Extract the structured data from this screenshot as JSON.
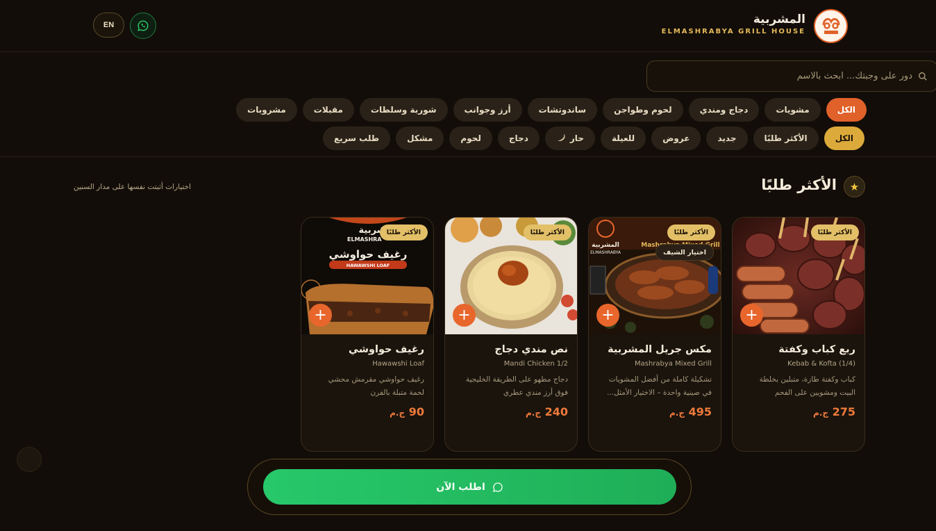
{
  "header": {
    "brand_ar": "المشربية",
    "brand_en": "ELMASHRABYA GRILL HOUSE",
    "lang": "EN",
    "logo_text": "المشربية"
  },
  "search": {
    "placeholder": "دور على وجبتك... ابحث بالاسم"
  },
  "categories": [
    "الكل",
    "مشويات",
    "دجاج ومندي",
    "لحوم وطواجن",
    "ساندوتشات",
    "أرز وجوانب",
    "شوربة وسلطات",
    "مقبلات",
    "مشروبات"
  ],
  "filters": [
    "الكل",
    "الأكثر طلبًا",
    "جديد",
    "عروض",
    "للعيلة",
    "حار",
    "دجاج",
    "لحوم",
    "مشكل",
    "طلب سريع"
  ],
  "section": {
    "title": "الأكثر طلبًا",
    "subtitle": "اختيارات أثبتت نفسها على مدار السنين"
  },
  "cards": [
    {
      "name": "ربع كباب وكفتة",
      "en": "Kebab & Kofta (1/4)",
      "desc": "كباب وكفتة طازة، متبلين بخلطة البيت ومشويين على الفحم",
      "price": "275",
      "currency": "ج.م",
      "badge": "الأكثر طلبًا"
    },
    {
      "name": "مكس جريل المشربية",
      "en": "Mashrabya Mixed Grill",
      "desc": "تشكيلة كاملة من أفضل المشويات في صينية واحدة – الاختيار الأمثل...",
      "price": "495",
      "currency": "ج.م",
      "badge": "الأكثر طلبًا",
      "badge2": "اختيار الشيف",
      "img_title": "المشربية",
      "img_sub": "ELMASHRABYA",
      "img_label": "Mashrabya Mixed Grill"
    },
    {
      "name": "نص مندي دجاج",
      "en": "Mandi Chicken 1/2",
      "desc": "دجاج مطهو على الطريقة الخليجية فوق أرز مندي عطري",
      "price": "240",
      "currency": "ج.م",
      "badge": "الأكثر طلبًا"
    },
    {
      "name": "رغيف حواوشي",
      "en": "Hawawshi Loaf",
      "desc": "رغيف حواوشي مقرمش محشي لحمة متبلة بالفرن",
      "price": "90",
      "currency": "ج.م",
      "badge": "الأكثر طلبًا",
      "img_title": "رغيف حواوشي",
      "img_sub": "HAWAWSHI LOAF",
      "img_brand": "المشربية",
      "img_brand_en": "ELMASHRA"
    }
  ],
  "order": {
    "label": "اطلب الآن"
  },
  "colors": {
    "accent": "#e0612a",
    "gold": "#dcaa3a",
    "green": "#25c467",
    "bg": "#120d08"
  }
}
